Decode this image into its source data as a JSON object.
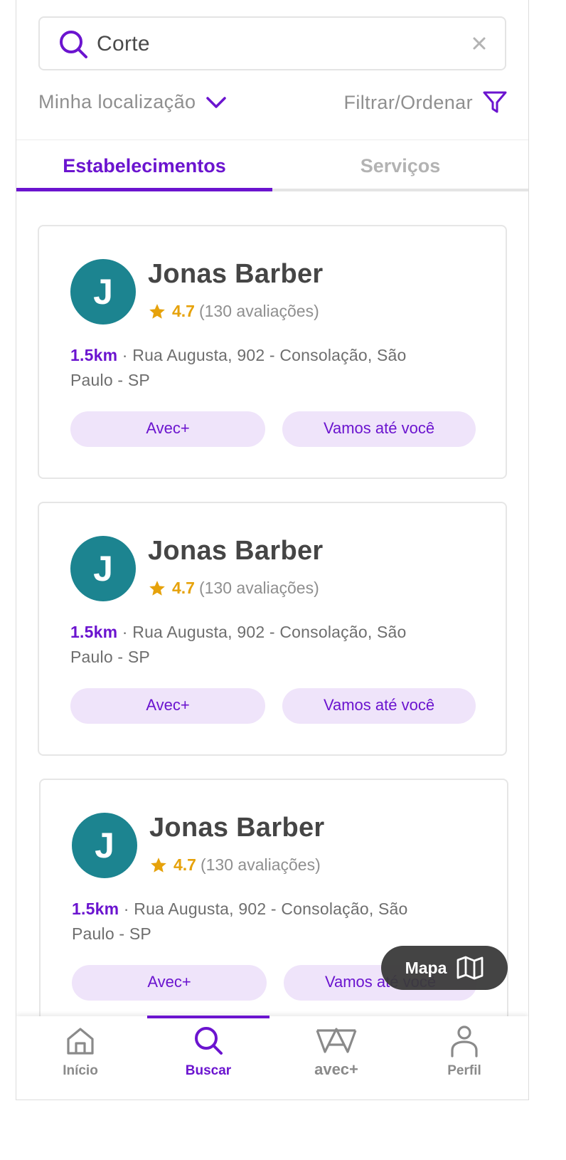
{
  "search": {
    "value": "Corte",
    "icon": "search-icon",
    "clear_icon": "close-icon"
  },
  "location": {
    "label": "Minha localização",
    "icon": "chevron-down-icon"
  },
  "filter": {
    "label": "Filtrar/Ordenar",
    "icon": "filter-icon"
  },
  "tabs": [
    {
      "label": "Estabelecimentos",
      "active": true
    },
    {
      "label": "Serviços",
      "active": false
    }
  ],
  "cards": [
    {
      "initial": "J",
      "name": "Jonas Barber",
      "score": "4.7",
      "reviews": "(130 avaliações)",
      "distance": "1.5km",
      "address": " · Rua Augusta, 902 - Consolação, São Paulo - SP",
      "tag1": "Avec+",
      "tag2": "Vamos até você"
    },
    {
      "initial": "J",
      "name": "Jonas Barber",
      "score": "4.7",
      "reviews": "(130 avaliações)",
      "distance": "1.5km",
      "address": " · Rua Augusta, 902 - Consolação, São Paulo - SP",
      "tag1": "Avec+",
      "tag2": "Vamos até você"
    },
    {
      "initial": "J",
      "name": "Jonas Barber",
      "score": "4.7",
      "reviews": "(130 avaliações)",
      "distance": "1.5km",
      "address": " · Rua Augusta, 902 - Consolação, São Paulo - SP",
      "tag1": "Avec+",
      "tag2": "Vamos até você"
    }
  ],
  "map_button": {
    "label": "Mapa",
    "icon": "map-icon"
  },
  "bottom_nav": [
    {
      "label": "Início",
      "icon": "home-icon",
      "active": false
    },
    {
      "label": "Buscar",
      "icon": "search-icon",
      "active": true
    },
    {
      "label": "avec+",
      "icon": "avec-logo-icon",
      "active": false
    },
    {
      "label": "Perfil",
      "icon": "user-icon",
      "active": false
    }
  ],
  "colors": {
    "accent": "#6b14cf",
    "avatar": "#1c8490",
    "star": "#e6a20b",
    "pill_bg": "#efe4fa",
    "map_button_bg": "#3a3a3a"
  }
}
